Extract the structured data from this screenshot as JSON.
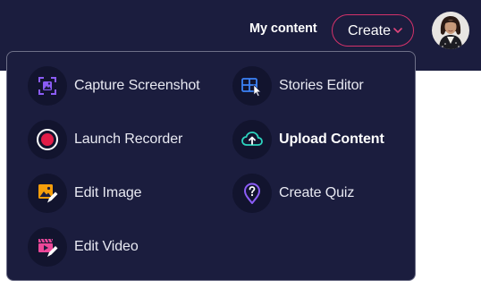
{
  "header": {
    "my_content_label": "My content",
    "create_label": "Create"
  },
  "menu": {
    "items": [
      {
        "label": "Capture Screenshot",
        "icon": "screenshot-icon"
      },
      {
        "label": "Stories Editor",
        "icon": "stories-editor-icon"
      },
      {
        "label": "Launch Recorder",
        "icon": "record-icon"
      },
      {
        "label": "Upload Content",
        "icon": "cloud-upload-icon"
      },
      {
        "label": "Edit Image",
        "icon": "edit-image-icon"
      },
      {
        "label": "Create Quiz",
        "icon": "quiz-icon"
      },
      {
        "label": "Edit Video",
        "icon": "edit-video-icon"
      }
    ]
  },
  "colors": {
    "background": "#1b1d3e",
    "accent": "#d4326a",
    "icon_purple": "#8b5cf6",
    "icon_blue": "#3b82f6",
    "icon_teal": "#2dd4bf",
    "icon_orange": "#f59e0b",
    "icon_pink": "#ec4899"
  }
}
